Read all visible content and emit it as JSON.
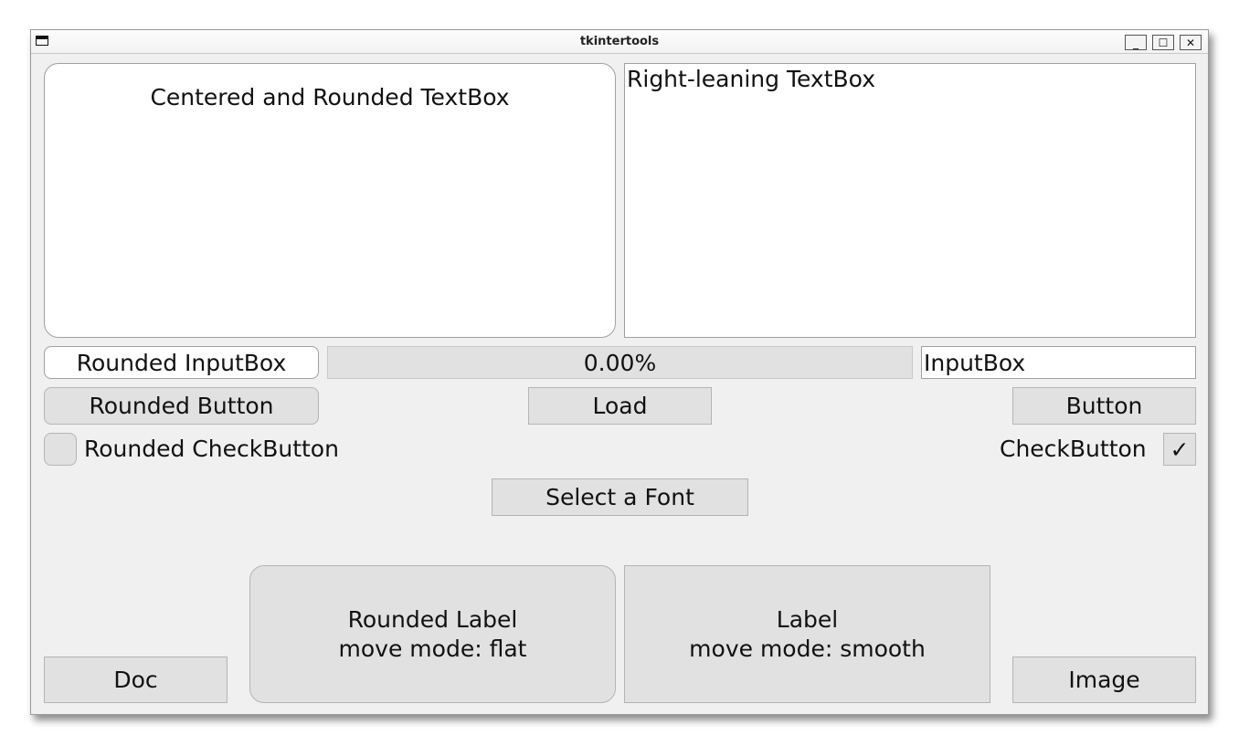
{
  "window": {
    "title": "tkintertools",
    "minimize": "_",
    "maximize": "☐",
    "close": "✕"
  },
  "textboxes": {
    "rounded": "Centered and Rounded TextBox",
    "right": "Right-leaning TextBox"
  },
  "inputs": {
    "rounded": "Rounded InputBox",
    "plain": "InputBox"
  },
  "progress": {
    "label": "0.00%",
    "value": 0.0
  },
  "buttons": {
    "rounded": "Rounded Button",
    "load": "Load",
    "plain": "Button",
    "select_font": "Select a Font",
    "doc": "Doc",
    "image": "Image"
  },
  "checkbuttons": {
    "rounded_label": "Rounded CheckButton",
    "rounded_checked": false,
    "plain_label": "CheckButton",
    "plain_checked": true,
    "check_glyph": "✓"
  },
  "labels": {
    "rounded_line1": "Rounded Label",
    "rounded_line2": "move mode: flat",
    "plain_line1": "Label",
    "plain_line2": "move mode: smooth"
  }
}
